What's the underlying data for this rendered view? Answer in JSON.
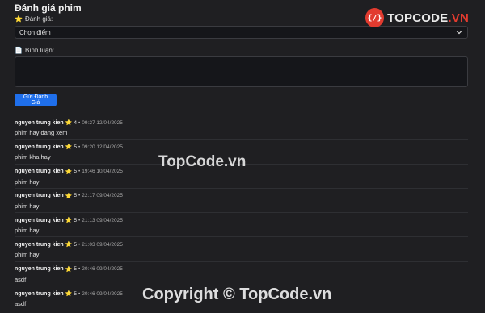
{
  "form": {
    "title": "Đánh giá phim",
    "rating_label": "Đánh giá:",
    "rating_emoji": "⭐",
    "rating_select_value": "Chọn điểm",
    "comment_label": "Bình luận:",
    "comment_emoji": "📄",
    "comment_value": "",
    "submit_label": "Gửi Đánh Giá"
  },
  "reviews": [
    {
      "user": "nguyen trung kien",
      "score": "4",
      "time": "09:27 12/04/2025",
      "text": "phim hay dang xem"
    },
    {
      "user": "nguyen trung kien",
      "score": "5",
      "time": "09:20 12/04/2025",
      "text": "phim kha hay"
    },
    {
      "user": "nguyen trung kien",
      "score": "5",
      "time": "19:46 10/04/2025",
      "text": "phim hay"
    },
    {
      "user": "nguyen trung kien",
      "score": "5",
      "time": "22:17 09/04/2025",
      "text": "phim hay"
    },
    {
      "user": "nguyen trung kien",
      "score": "5",
      "time": "21:13 09/04/2025",
      "text": "phim hay"
    },
    {
      "user": "nguyen trung kien",
      "score": "5",
      "time": "21:03 09/04/2025",
      "text": "phim hay"
    },
    {
      "user": "nguyen trung kien",
      "score": "5",
      "time": "20:46 09/04/2025",
      "text": "asdf"
    },
    {
      "user": "nguyen trung kien",
      "score": "5",
      "time": "20:46 09/04/2025",
      "text": "asdf"
    }
  ],
  "review_separator": "•",
  "star_glyph": "⭐",
  "logo": {
    "text_main": "TOPCODE",
    "text_suffix": ".VN",
    "mark": "{/}"
  },
  "watermarks": {
    "center": "TopCode.vn",
    "bottom": "Copyright © TopCode.vn"
  },
  "colors": {
    "accent": "#1f6feb",
    "background": "#1f1f22",
    "star": "#f5c518",
    "brand": "#e23b2f"
  }
}
